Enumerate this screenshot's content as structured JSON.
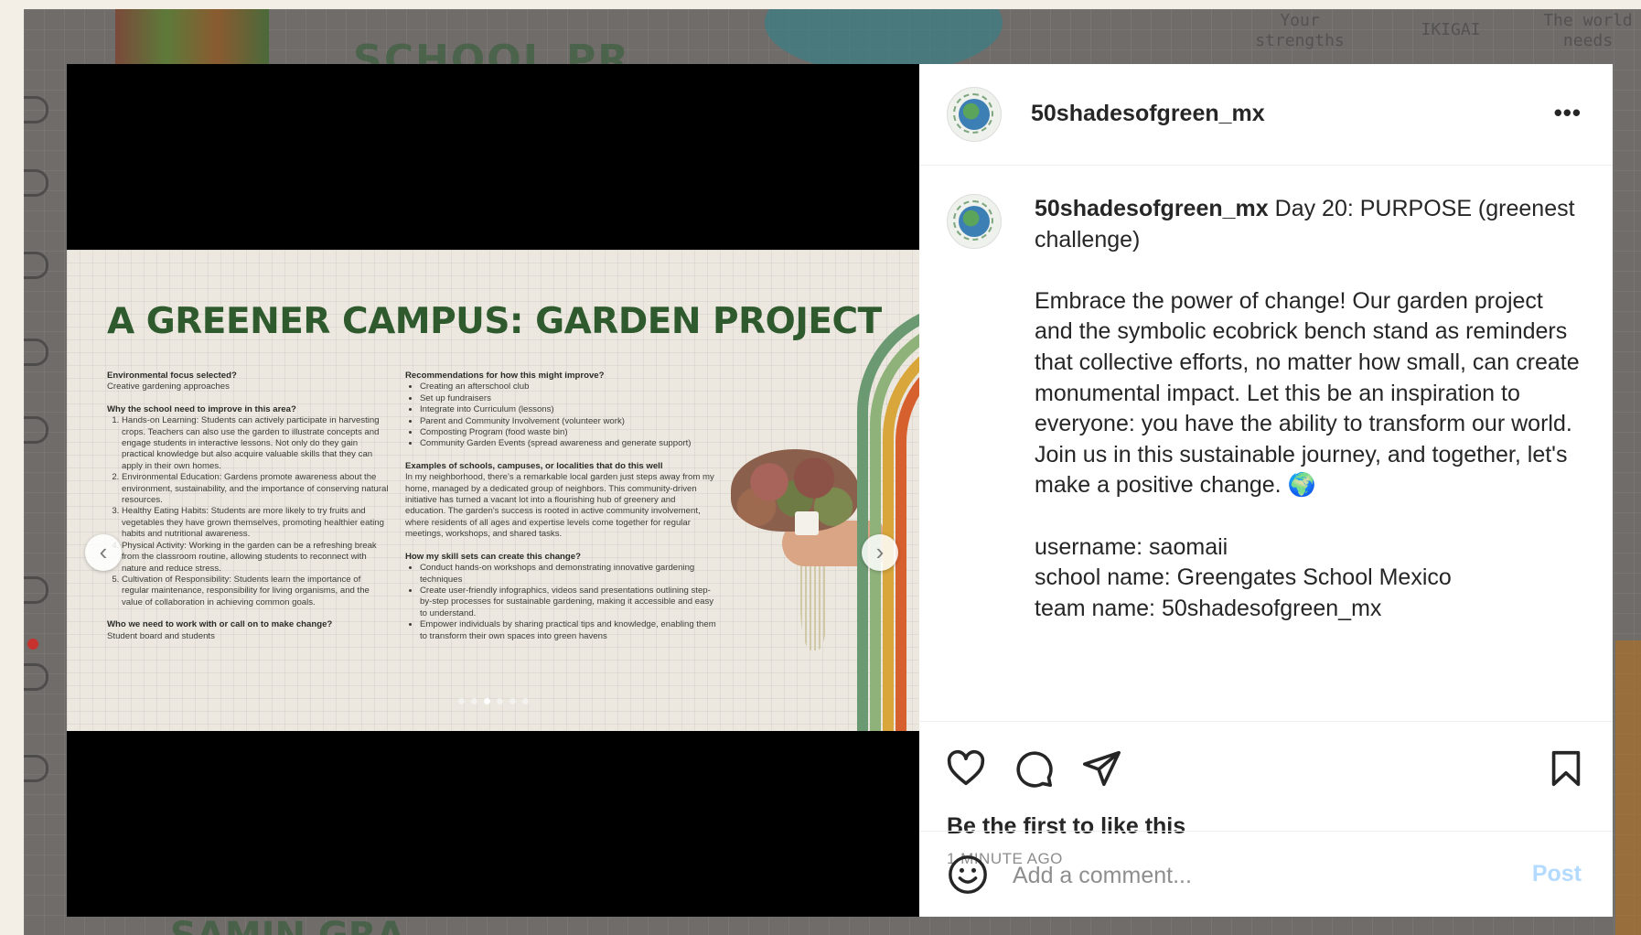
{
  "background": {
    "poster_title": "SCHOOL PR",
    "ikigai": {
      "center": "IKIGAI",
      "left": "Your strengths",
      "right": "The world needs"
    },
    "bottom_text": "SAMIN GRA"
  },
  "post": {
    "username": "50shadesofgreen_mx",
    "more_label": "•••",
    "caption_lead": " Day 20: PURPOSE (greenest challenge)",
    "caption_body": "Embrace the power of change! Our garden project and the symbolic ecobrick bench stand as reminders that collective efforts, no matter how small, can create monumental impact. Let this be an inspiration to everyone: you have the ability to transform our world. Join us in this sustainable journey, and together, let's make a positive change. 🌍",
    "details": [
      "username: saomaii",
      "school name: Greengates School Mexico",
      "team name: 50shadesofgreen_mx"
    ],
    "likes_text": "Be the first to like this",
    "time_ago": "1 MINUTE AGO",
    "comment_placeholder": "Add a comment...",
    "post_label": "Post"
  },
  "slide": {
    "title": "A GREENER CAMPUS: GARDEN PROJECT",
    "left": {
      "focus_heading": "Environmental focus selected?",
      "focus_value": "Creative gardening approaches",
      "why_heading": "Why the school need to improve in this area?",
      "reasons": [
        "Hands-on Learning: Students can actively participate in harvesting crops. Teachers can also use the garden to illustrate concepts and engage students in interactive lessons. Not only do they gain practical knowledge but also acquire valuable skills that they can apply in their own homes.",
        "Environmental Education: Gardens promote awareness about the environment, sustainability, and the importance of conserving natural resources.",
        "Healthy Eating Habits: Students are more likely to try fruits and vegetables they have grown themselves, promoting healthier eating habits and nutritional awareness.",
        "Physical Activity: Working in the garden can be a refreshing break from the classroom routine, allowing students to reconnect with nature and reduce stress.",
        "Cultivation of Responsibility: Students learn the importance of regular maintenance, responsibility for living organisms, and the value of collaboration in achieving common goals."
      ],
      "who_heading": "Who we need to work with or call on to make change?",
      "who_value": "Student board and students"
    },
    "right": {
      "rec_heading": "Recommendations for how this might improve?",
      "recommendations": [
        "Creating an afterschool club",
        "Set up fundraisers",
        "Integrate into Curriculum (lessons)",
        "Parent and Community Involvement (volunteer work)",
        "Composting Program (food waste bin)",
        "Community Garden Events (spread awareness and generate support)"
      ],
      "examples_heading": "Examples of schools, campuses, or localities that do this well",
      "examples_body": "In my neighborhood, there's a remarkable local garden just steps away from my home, managed by a dedicated group of neighbors. This community-driven initiative has turned a vacant lot into a flourishing hub of greenery and education. The garden's success is rooted in active community involvement, where residents of all ages and expertise levels come together for regular meetings, workshops, and shared tasks.",
      "skills_heading": "How my skill sets can create this change?",
      "skills": [
        "Conduct hands-on workshops and demonstrating innovative gardening techniques",
        "Create user-friendly infographics, videos sand presentations outlining step-by-step processes for sustainable gardening, making it accessible and easy to understand.",
        "Empower individuals by sharing practical tips and knowledge, enabling them to transform their own spaces into green havens"
      ]
    },
    "carousel": {
      "count": 6,
      "active_index": 2
    },
    "prev_label": "‹",
    "next_label": "›"
  },
  "colors": {
    "title_green": "#2f5a2e",
    "rainbow": [
      "#6b9a72",
      "#8fb27a",
      "#d8a63a",
      "#d7602f",
      "#cf4a2a"
    ],
    "post_button": "#b3dbff"
  }
}
